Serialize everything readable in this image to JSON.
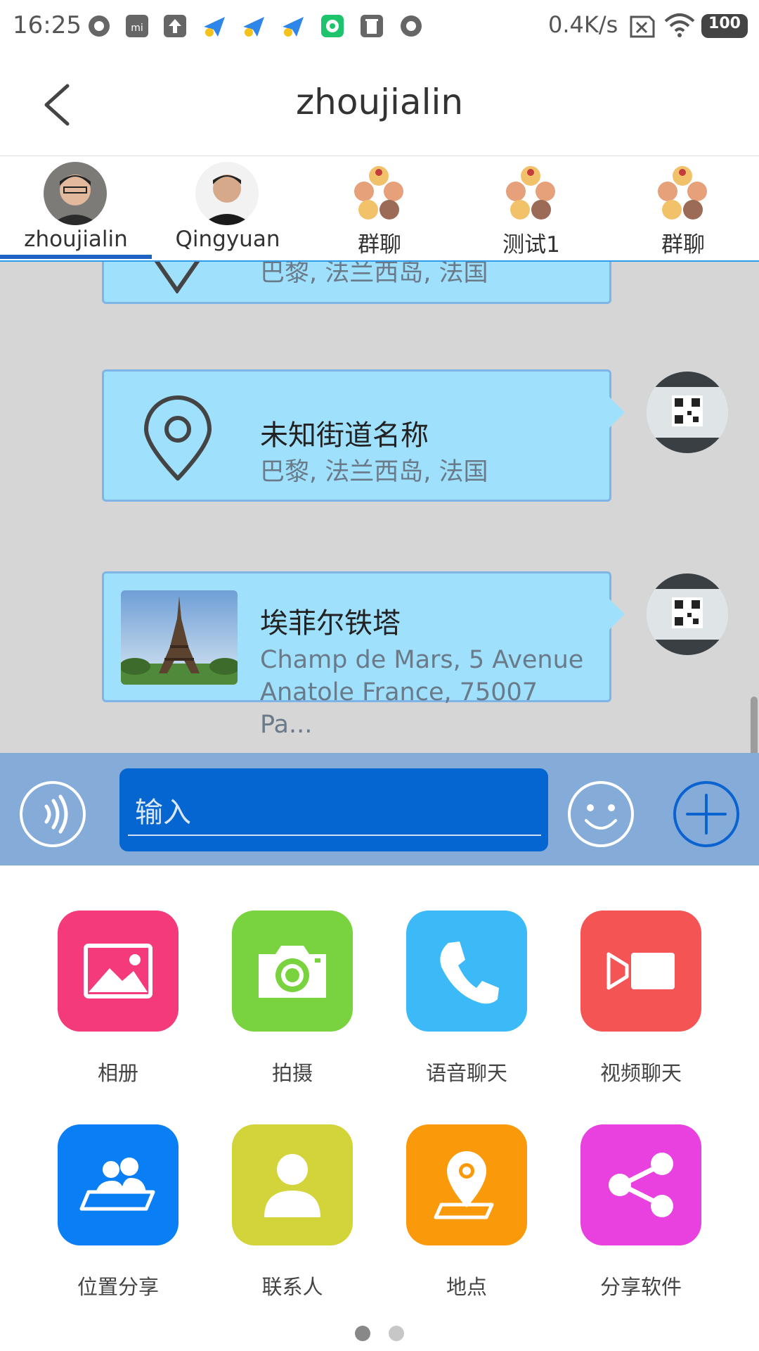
{
  "status_bar": {
    "time": "16:25",
    "net_speed": "0.4K/s",
    "battery": "100",
    "icons": [
      "circle-icon",
      "mi-icon",
      "upload-icon",
      "plane-icon",
      "plane-icon",
      "plane-icon",
      "wechat-icon",
      "trash-icon",
      "circle-icon"
    ]
  },
  "header": {
    "title": "zhoujialin",
    "back_icon": "chevron-left-icon"
  },
  "tabs": [
    {
      "label": "zhoujialin",
      "active": true
    },
    {
      "label": "Qingyuan",
      "active": false
    },
    {
      "label": "群聊",
      "active": false
    },
    {
      "label": "测试1",
      "active": false
    },
    {
      "label": "群聊",
      "active": false
    }
  ],
  "messages": [
    {
      "subtitle": "巴黎, 法兰西岛, 法国",
      "icon": "map-pin-icon"
    },
    {
      "title": "未知街道名称",
      "subtitle": "巴黎, 法兰西岛, 法国",
      "icon": "map-pin-icon"
    },
    {
      "title": "埃菲尔铁塔",
      "subtitle": "Champ de Mars, 5 Avenue Anatole France, 75007 Pa...",
      "icon": "eiffel-tower-photo"
    }
  ],
  "input": {
    "placeholder": "输入"
  },
  "actions": [
    {
      "label": "相册",
      "icon": "gallery-icon",
      "color": "#f43a7a"
    },
    {
      "label": "拍摄",
      "icon": "camera-icon",
      "color": "#78d33e"
    },
    {
      "label": "语音聊天",
      "icon": "phone-icon",
      "color": "#3cbaf8"
    },
    {
      "label": "视频聊天",
      "icon": "video-icon",
      "color": "#f45454"
    },
    {
      "label": "位置分享",
      "icon": "location-share-icon",
      "color": "#0a7ff5"
    },
    {
      "label": "联系人",
      "icon": "contact-icon",
      "color": "#d3d43a"
    },
    {
      "label": "地点",
      "icon": "place-icon",
      "color": "#fa990a"
    },
    {
      "label": "分享软件",
      "icon": "share-icon",
      "color": "#e841e0"
    }
  ],
  "pager": {
    "pages": 2,
    "current": 1
  },
  "colors": {
    "chat_bg": "#d6d6d6",
    "bubble": "#9fe0fc",
    "input_bar": "#85abd8",
    "input_field": "#0566d2",
    "tab_indicator": "#1f63c7"
  }
}
